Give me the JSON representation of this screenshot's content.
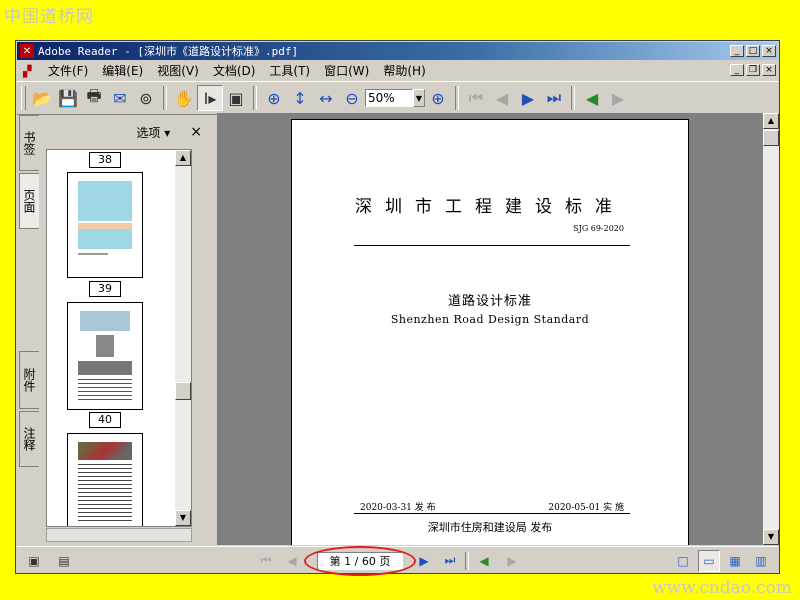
{
  "watermarks": {
    "top": "中国道桥网",
    "bottom": "www.cndao.com"
  },
  "window": {
    "title": "Adobe Reader - [深圳市《道路设计标准》.pdf]",
    "app_icon": "adobe-reader-icon"
  },
  "window_controls": {
    "minimize": "_",
    "maximize": "□",
    "close": "×",
    "restore": "❐"
  },
  "menu": {
    "items": [
      "文件(F)",
      "编辑(E)",
      "视图(V)",
      "文档(D)",
      "工具(T)",
      "窗口(W)",
      "帮助(H)"
    ]
  },
  "toolbar": {
    "icons": [
      "open-folder-icon",
      "save-icon",
      "print-icon",
      "email-icon",
      "search-binoculars-icon",
      "hand-tool-icon",
      "select-text-tool-icon",
      "snapshot-tool-icon",
      "zoom-in-tool-icon",
      "fit-page-icon",
      "fit-width-icon",
      "zoom-out-icon",
      "zoom-in-icon",
      "first-page-icon",
      "previous-page-icon",
      "next-page-icon",
      "last-page-icon",
      "go-back-icon",
      "go-forward-icon"
    ],
    "zoom_value": "50%"
  },
  "side_tabs": {
    "bookmarks": "书签",
    "pages": "页面",
    "attachments": "附件",
    "comments": "注释"
  },
  "panel": {
    "options_label": "选项 ▾",
    "close_label": "×",
    "page_labels": [
      "38",
      "39",
      "40"
    ]
  },
  "document": {
    "standard_series": "深圳市工程建设标准",
    "code": "SJG 69-2020",
    "title_cn": "道路设计标准",
    "title_en": "Shenzhen Road Design Standard",
    "issue_date": "2020-03-31 发 布",
    "effective_date": "2020-05-01 实 施",
    "publisher": "深圳市住房和建设局   发布"
  },
  "statusbar": {
    "page_indicator": "第 1 / 60 页",
    "current_page": 1,
    "total_pages": 60
  },
  "colors": {
    "highlight_ellipse": "#e02020",
    "titlebar": "#0a246a",
    "background": "#ffff00"
  }
}
